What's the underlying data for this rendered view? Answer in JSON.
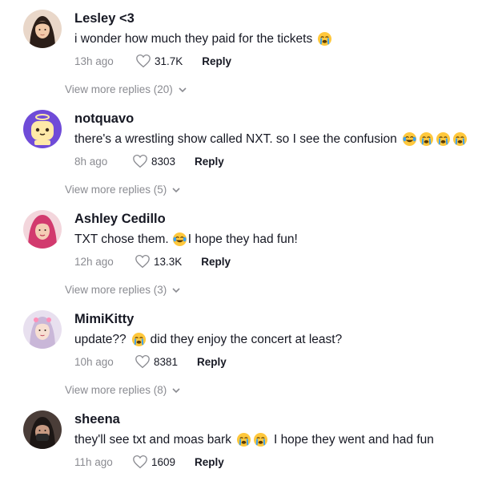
{
  "comments": [
    {
      "username": "Lesley <3",
      "text_parts": [
        "i wonder how much they paid for the tickets"
      ],
      "emojis": [
        "loudly-crying-face"
      ],
      "time": "13h ago",
      "likes": "31.7K",
      "reply_label": "Reply",
      "view_more": "View more replies (20)"
    },
    {
      "username": "notquavo",
      "text_parts": [
        "there's a wrestling show called NXT. so I see the confusion"
      ],
      "emojis": [
        "face-with-tears-of-joy",
        "loudly-crying-face",
        "loudly-crying-face",
        "loudly-crying-face"
      ],
      "time": "8h ago",
      "likes": "8303",
      "reply_label": "Reply",
      "view_more": "View more replies (5)"
    },
    {
      "username": "Ashley Cedillo",
      "text_parts": [
        "TXT chose them.",
        "I hope they had fun!"
      ],
      "emojis": [
        "face-with-tears-of-joy"
      ],
      "time": "12h ago",
      "likes": "13.3K",
      "reply_label": "Reply",
      "view_more": "View more replies (3)"
    },
    {
      "username": "MimiKitty",
      "text_parts": [
        "update??",
        "did they enjoy the concert at least?"
      ],
      "emojis": [
        "loudly-crying-face"
      ],
      "time": "10h ago",
      "likes": "8381",
      "reply_label": "Reply",
      "view_more": "View more replies (8)"
    },
    {
      "username": "sheena",
      "text_parts": [
        "they'll see txt and moas bark",
        "I hope they went and had fun"
      ],
      "emojis": [
        "loudly-crying-face",
        "loudly-crying-face"
      ],
      "time": "11h ago",
      "likes": "1609",
      "reply_label": "Reply"
    }
  ],
  "icons": {
    "like": "heart-outline-icon",
    "expand": "chevron-down-icon"
  },
  "colors": {
    "text_primary": "#161823",
    "text_secondary": "#8a8b91",
    "emoji_face": "#ffc83d",
    "emoji_tears": "#3aa0f0"
  }
}
